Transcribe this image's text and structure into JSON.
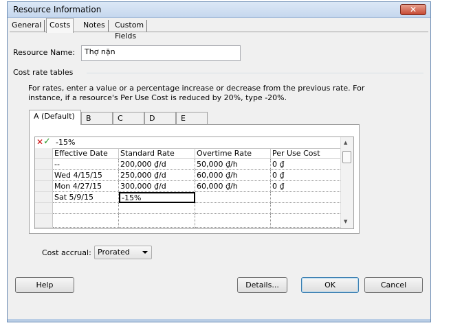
{
  "window": {
    "title": "Resource Information",
    "close_glyph": "✕"
  },
  "tabs": [
    {
      "label": "General"
    },
    {
      "label": "Costs"
    },
    {
      "label": "Notes"
    },
    {
      "label": "Custom Fields"
    }
  ],
  "resource": {
    "name_label": "Resource Name:",
    "name_value": "Thợ nặn"
  },
  "cost_rate": {
    "group_label": "Cost rate tables",
    "instructions_line1": "For rates, enter a value or a percentage increase or decrease from the previous rate. For",
    "instructions_line2": "instance, if a resource's Per Use Cost is reduced by 20%, type -20%.",
    "tables": [
      "A (Default)",
      "B",
      "C",
      "D",
      "E"
    ],
    "edit_value": "-15%",
    "columns": [
      "Effective Date",
      "Standard Rate",
      "Overtime Rate",
      "Per Use Cost"
    ],
    "rows": [
      [
        "--",
        "200,000 ₫/d",
        "50,000 ₫/h",
        "0 ₫"
      ],
      [
        "Wed 4/15/15",
        "250,000 ₫/d",
        "60,000 ₫/h",
        "0 ₫"
      ],
      [
        "Mon 4/27/15",
        "300,000 ₫/d",
        "60,000 ₫/h",
        "0 ₫"
      ],
      [
        "Sat 5/9/15",
        "-15%",
        "",
        ""
      ]
    ]
  },
  "accrual": {
    "label": "Cost accrual:",
    "value": "Prorated"
  },
  "buttons": {
    "help": "Help",
    "details": "Details...",
    "ok": "OK",
    "cancel": "Cancel"
  },
  "colors": {
    "cancel_icon": "#cc0000",
    "accept_icon": "#2a9a2a"
  }
}
